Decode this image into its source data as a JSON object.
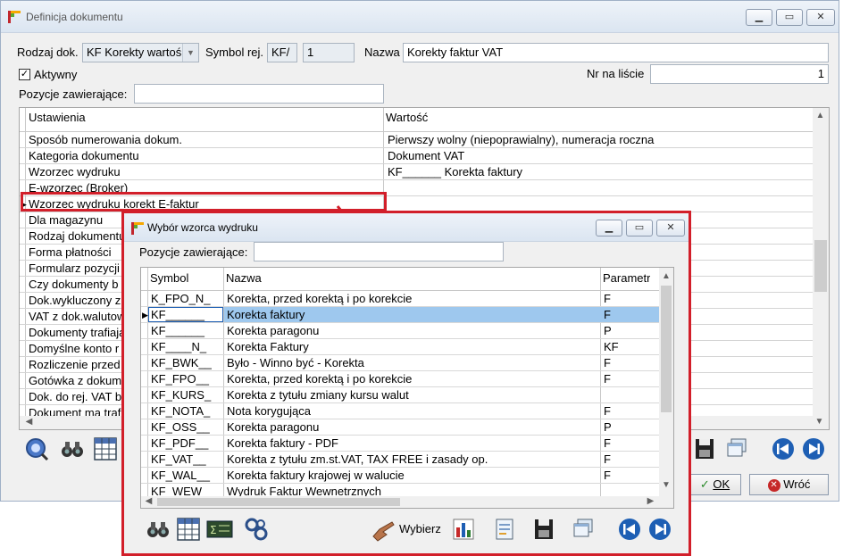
{
  "main": {
    "title": "Definicja dokumentu",
    "rodzaj_label": "Rodzaj dok.",
    "rodzaj_value": "KF Korekty wartoś",
    "symbol_label": "Symbol rej.",
    "symbol_value1": "KF/",
    "symbol_value2": "1",
    "nazwa_label": "Nazwa",
    "nazwa_value": "Korekty faktur VAT",
    "aktywny_label": "Aktywny",
    "nr_label": "Nr na liście",
    "nr_value": "1",
    "pozycje_label": "Pozycje zawierające:",
    "pozycje_value": "",
    "grid": {
      "col1": "Ustawienia",
      "col2": "Wartość",
      "rows": [
        {
          "name": "Sposób numerowania dokum.",
          "value": "Pierwszy wolny  (niepoprawialny), numeracja roczna"
        },
        {
          "name": "Kategoria dokumentu",
          "value": "Dokument VAT"
        },
        {
          "name": "Wzorzec wydruku",
          "value": "KF______ Korekta faktury"
        },
        {
          "name": "E-wzorzec (Broker)",
          "value": ""
        },
        {
          "name": "Wzorzec wydruku korekt E-faktur",
          "value": ""
        },
        {
          "name": "Dla magazynu",
          "value": ""
        },
        {
          "name": "Rodzaj dokumentu",
          "value": ""
        },
        {
          "name": "Forma płatności",
          "value": ""
        },
        {
          "name": "Formularz pozycji",
          "value": ""
        },
        {
          "name": "Czy dokumenty b",
          "value": ""
        },
        {
          "name": "Dok.wykluczony z",
          "value": ""
        },
        {
          "name": "VAT z dok.walutow",
          "value": ""
        },
        {
          "name": "Dokumenty trafiają",
          "value": ""
        },
        {
          "name": "Domyślne konto r",
          "value": ""
        },
        {
          "name": "Rozliczenie przed",
          "value": ""
        },
        {
          "name": "Gotówka z dokum",
          "value": ""
        },
        {
          "name": "Dok. do rej. VAT b",
          "value": ""
        },
        {
          "name": "Dokument ma traf",
          "value": ""
        }
      ]
    },
    "ok_label": "OK",
    "wroc_label": "Wróć"
  },
  "popup": {
    "title": "Wybór wzorca wydruku",
    "pozycje_label": "Pozycje zawierające:",
    "pozycje_value": "",
    "col_symbol": "Symbol",
    "col_nazwa": "Nazwa",
    "col_param": "Parametr",
    "rows": [
      {
        "symbol": "K_FPO_N_",
        "nazwa": "Korekta, przed korektą i po korekcie",
        "param": "F"
      },
      {
        "symbol": "KF______",
        "nazwa": "Korekta faktury",
        "param": "F"
      },
      {
        "symbol": "KF______",
        "nazwa": "Korekta paragonu",
        "param": "P"
      },
      {
        "symbol": "KF____N_",
        "nazwa": "Korekta Faktury",
        "param": "KF"
      },
      {
        "symbol": "KF_BWK__",
        "nazwa": "Było - Winno być - Korekta",
        "param": "F"
      },
      {
        "symbol": "KF_FPO__",
        "nazwa": "Korekta, przed korektą i po korekcie",
        "param": "F"
      },
      {
        "symbol": "KF_KURS_",
        "nazwa": "Korekta z tytułu zmiany kursu walut",
        "param": ""
      },
      {
        "symbol": "KF_NOTA_",
        "nazwa": "Nota korygująca",
        "param": "F"
      },
      {
        "symbol": "KF_OSS__",
        "nazwa": "Korekta paragonu",
        "param": "P"
      },
      {
        "symbol": "KF_PDF__",
        "nazwa": "Korekta faktury - PDF",
        "param": "F"
      },
      {
        "symbol": "KF_VAT__",
        "nazwa": "Korekta z tytułu zm.st.VAT, TAX FREE i zasady op.",
        "param": "F"
      },
      {
        "symbol": "KF_WAL__",
        "nazwa": "Korekta faktury krajowej w walucie",
        "param": "F"
      },
      {
        "symbol": "KF_WEW",
        "nazwa": "Wydruk Faktur Wewnetrznych",
        "param": ""
      }
    ],
    "wybierz_label": "Wybierz"
  },
  "colors": {
    "highlight": "#d21f2a",
    "selection": "#9ec8ee",
    "accent": "#1e5fb4"
  },
  "icons": [
    "app-icon",
    "minimize-icon",
    "maximize-icon",
    "close-icon",
    "search-globe-icon",
    "binoculars-icon",
    "grid-view-icon",
    "sigma-icon",
    "settings-icon",
    "hand-pointer-icon",
    "chart-icon",
    "document-icon",
    "save-icon",
    "windows-icon",
    "first-icon",
    "next-icon",
    "checkmark-icon",
    "cancel-icon"
  ]
}
